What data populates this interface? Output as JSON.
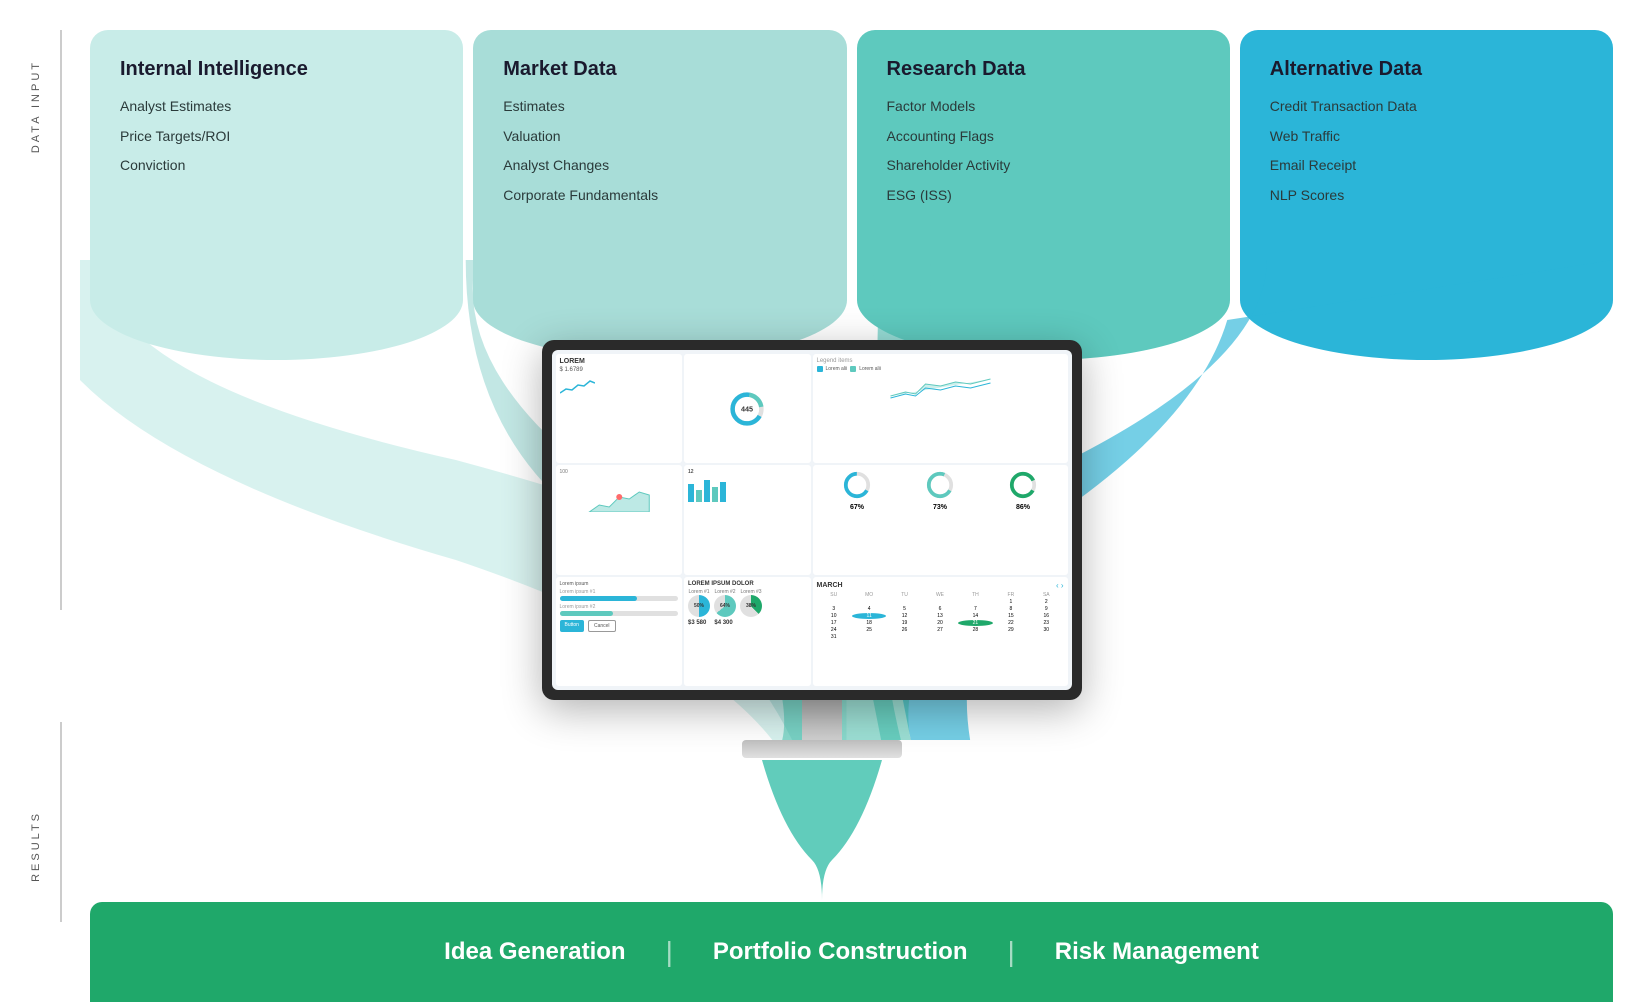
{
  "labels": {
    "data_input": "DATA INPUT",
    "results": "RESULTS"
  },
  "columns": [
    {
      "id": "internal",
      "title": "Internal Intelligence",
      "color": "#c8ece8",
      "items": [
        "Analyst Estimates",
        "Price Targets/ROI",
        "Conviction"
      ]
    },
    {
      "id": "market",
      "title": "Market Data",
      "color": "#a8ddd8",
      "items": [
        "Estimates",
        "Valuation",
        "Analyst Changes",
        "Corporate Fundamentals"
      ]
    },
    {
      "id": "research",
      "title": "Research Data",
      "color": "#5ec9be",
      "items": [
        "Factor Models",
        "Accounting Flags",
        "Shareholder Activity",
        "ESG (ISS)"
      ]
    },
    {
      "id": "alternative",
      "title": "Alternative Data",
      "color": "#2bb5d8",
      "items": [
        "Credit Transaction Data",
        "Web Traffic",
        "Email Receipt",
        "NLP Scores"
      ]
    }
  ],
  "results": {
    "items": [
      "Idea Generation",
      "Portfolio Construction",
      "Risk Management"
    ],
    "separator": "|"
  }
}
